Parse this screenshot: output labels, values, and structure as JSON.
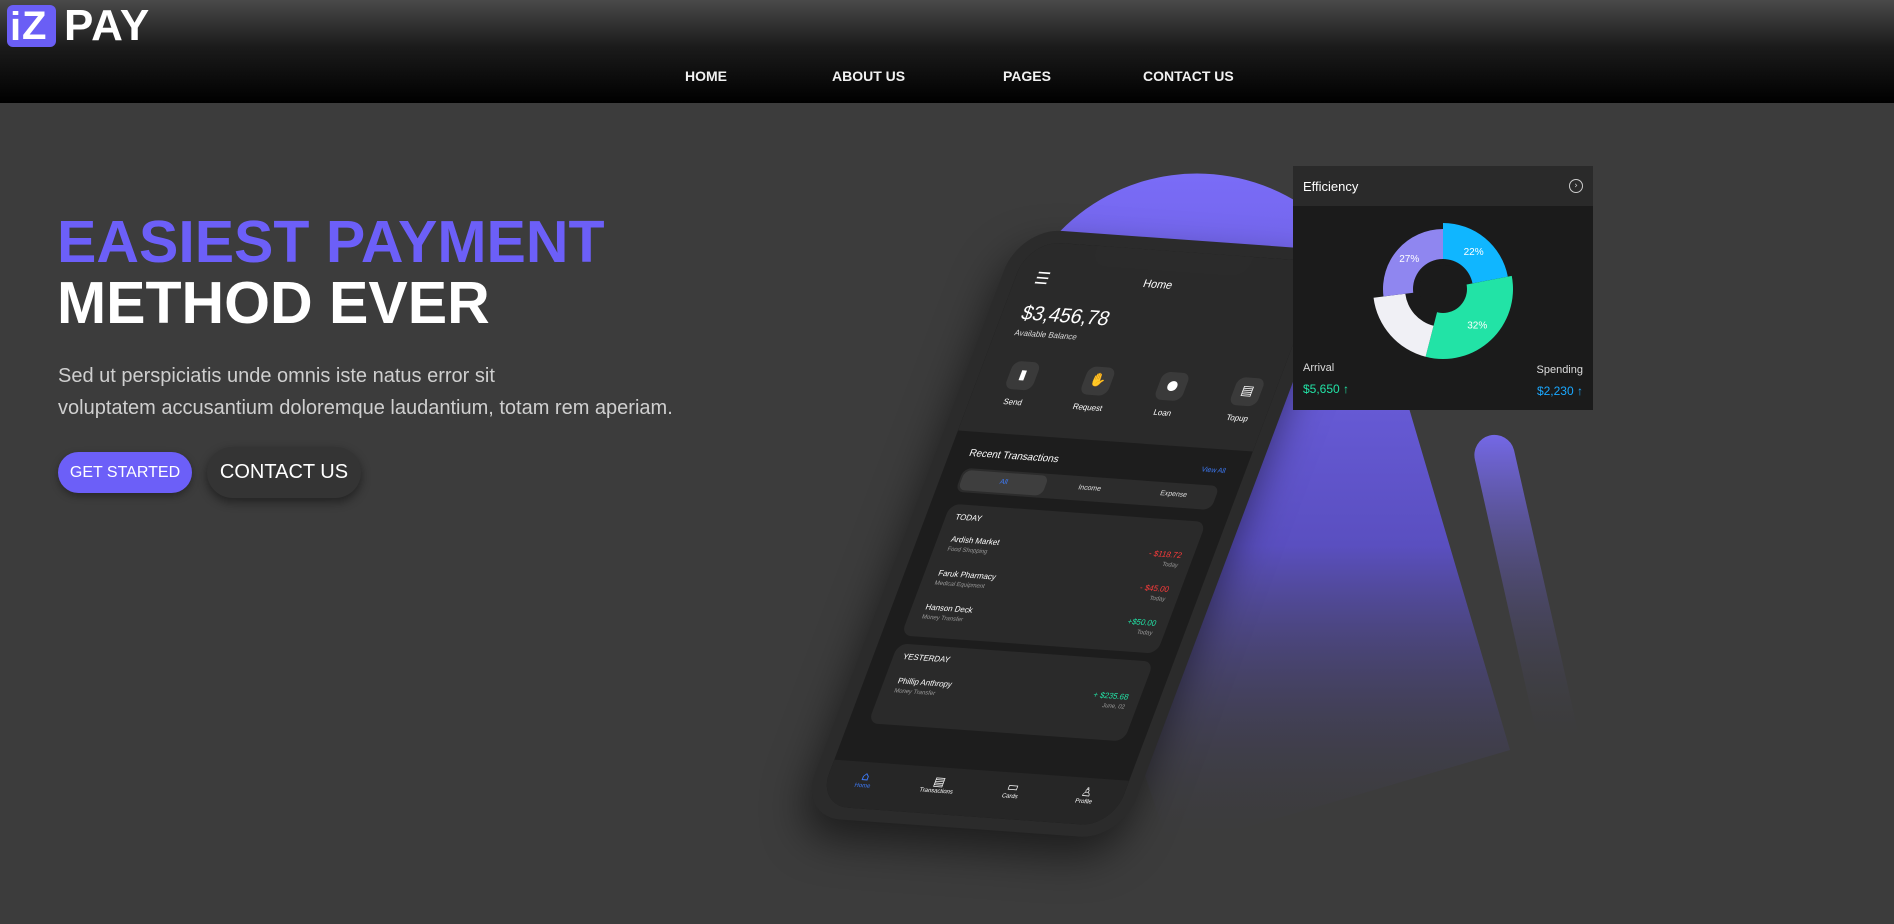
{
  "brand": {
    "mark_i": "i",
    "mark_z": "Z",
    "name": "PAY"
  },
  "nav": {
    "items": [
      "HOME",
      "ABOUT US",
      "PAGES",
      "CONTACT US"
    ]
  },
  "hero": {
    "title_line1": "EASIEST PAYMENT",
    "title_line2": "METHOD EVER",
    "description_line1": "Sed ut perspiciatis unde omnis iste natus error sit",
    "description_line2": "voluptatem accusantium doloremque laudantium, totam rem aperiam.",
    "primary_button": "GET STARTED",
    "secondary_button": "CONTACT US"
  },
  "phone": {
    "header": "Home",
    "balance": "$3,456,78",
    "balance_label": "Available Balance",
    "actions": [
      "Send",
      "Request",
      "Loan",
      "Topup"
    ],
    "recent_title": "Recent Transactions",
    "view_all": "View All",
    "segments": [
      "All",
      "Income",
      "Expense"
    ],
    "today_label": "TODAY",
    "yesterday_label": "YESTERDAY",
    "today": [
      {
        "name": "Ardish Market",
        "sub": "Food Shopping",
        "amount": "- $118.72",
        "date": "Today",
        "type": "out"
      },
      {
        "name": "Faruk Pharmacy",
        "sub": "Medical Equipment",
        "amount": "- $45.00",
        "date": "Today",
        "type": "out"
      },
      {
        "name": "Hanson Deck",
        "sub": "Money Transfer",
        "amount": "+$50.00",
        "date": "Today",
        "type": "in"
      }
    ],
    "yesterday": [
      {
        "name": "Phillip Anthropy",
        "sub": "Money Transfer",
        "amount": "+ $235.68",
        "date": "June, 02",
        "type": "in"
      }
    ],
    "tabs": [
      "Home",
      "Transactions",
      "Cards",
      "Profile"
    ]
  },
  "efficiency": {
    "title": "Efficiency",
    "arrival_label": "Arrival",
    "arrival_value": "$5,650 ↑",
    "spending_label": "Spending",
    "spending_value": "$2,230 ↑"
  },
  "chart_data": {
    "type": "pie",
    "categories": [
      "22%",
      "32%",
      "",
      "27%"
    ],
    "values": [
      22,
      32,
      19,
      27
    ],
    "colors": [
      "#10b6ff",
      "#22e3a6",
      "#f0f0f5",
      "#8f86f0"
    ]
  },
  "colors": {
    "accent": "#6c5ff8",
    "income": "#22e3a6",
    "expense": "#ff3b3b",
    "link": "#3d7bfa"
  }
}
